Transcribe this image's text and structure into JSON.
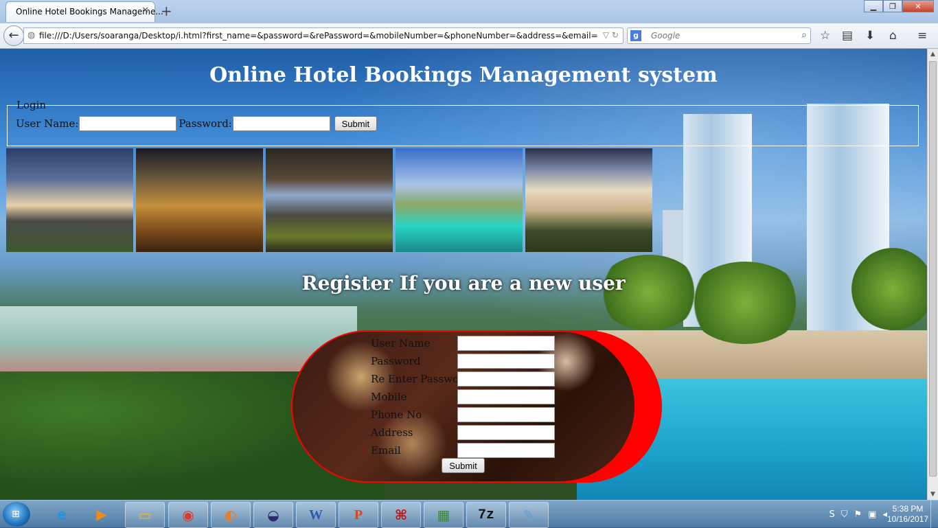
{
  "browser": {
    "tab_title": "Online Hotel Bookings Manageme...",
    "new_tab": "+",
    "url": "file:///D:/Users/soaranga/Desktop/i.html?first_name=&password=&rePassword=&mobileNumber=&phoneNumber=&address=&email=",
    "search_placeholder": "Google",
    "search_engine_icon": "g-icon"
  },
  "page": {
    "title": "Online Hotel Bookings Management system",
    "login": {
      "legend": "Login",
      "username_label": "User Name:",
      "username_value": "",
      "password_label": "Password:",
      "password_value": "",
      "submit_label": "Submit"
    },
    "gallery": [
      "hotel-exterior-night",
      "restaurant-lounge",
      "hotel-lounge-interior",
      "resort-pool-sunset",
      "hotel-palacio-exterior"
    ],
    "register": {
      "heading": "Register If you are a new user",
      "fields": [
        {
          "label": "User Name",
          "value": ""
        },
        {
          "label": "Password",
          "value": ""
        },
        {
          "label": "Re Enter Password",
          "value": ""
        },
        {
          "label": "Mobile",
          "value": ""
        },
        {
          "label": "Phone No",
          "value": ""
        },
        {
          "label": "Address",
          "value": ""
        },
        {
          "label": "Email",
          "value": ""
        }
      ],
      "submit_label": "Submit"
    }
  },
  "taskbar": {
    "apps": [
      "internet-explorer",
      "media-player",
      "file-explorer",
      "chrome",
      "firefox",
      "eclipse",
      "word",
      "powerpoint",
      "acrobat",
      "project",
      "7zip",
      "notepad"
    ],
    "clock_time": "5:38 PM",
    "clock_date": "10/16/2017"
  },
  "colors": {
    "register_border": "#ff0000",
    "heading_text": "#ffffff"
  }
}
